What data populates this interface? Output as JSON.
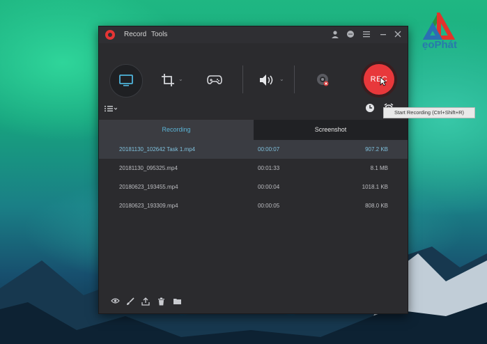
{
  "watermark": {
    "brand_text": "ẹoPhát"
  },
  "window": {
    "menu": {
      "record": "Record",
      "tools": "Tools"
    },
    "titlebar_icons": [
      "user-icon",
      "chat-icon",
      "menu-icon",
      "minimize-icon",
      "close-icon"
    ]
  },
  "toolbar": {
    "rec_label": "REC",
    "tooltip": "Start Recording (Ctrl+Shift+R)",
    "tools": [
      "screen-icon",
      "crop-icon",
      "gamepad-icon",
      "speaker-icon",
      "webcam-icon"
    ]
  },
  "tabs": {
    "recording": "Recording",
    "screenshot": "Screenshot"
  },
  "files": [
    {
      "name": "20181130_102642 Task 1.mp4",
      "duration": "00:00:07",
      "size": "907.2 KB",
      "selected": true
    },
    {
      "name": "20181130_095325.mp4",
      "duration": "00:01:33",
      "size": "8.1 MB",
      "selected": false
    },
    {
      "name": "20180623_193455.mp4",
      "duration": "00:00:04",
      "size": "1018.1 KB",
      "selected": false
    },
    {
      "name": "20180623_193309.mp4",
      "duration": "00:00:05",
      "size": "808.0 KB",
      "selected": false
    }
  ],
  "colors": {
    "accent": "#5bb4d6",
    "rec": "#e8383b",
    "window_bg": "#2b2b2e"
  }
}
